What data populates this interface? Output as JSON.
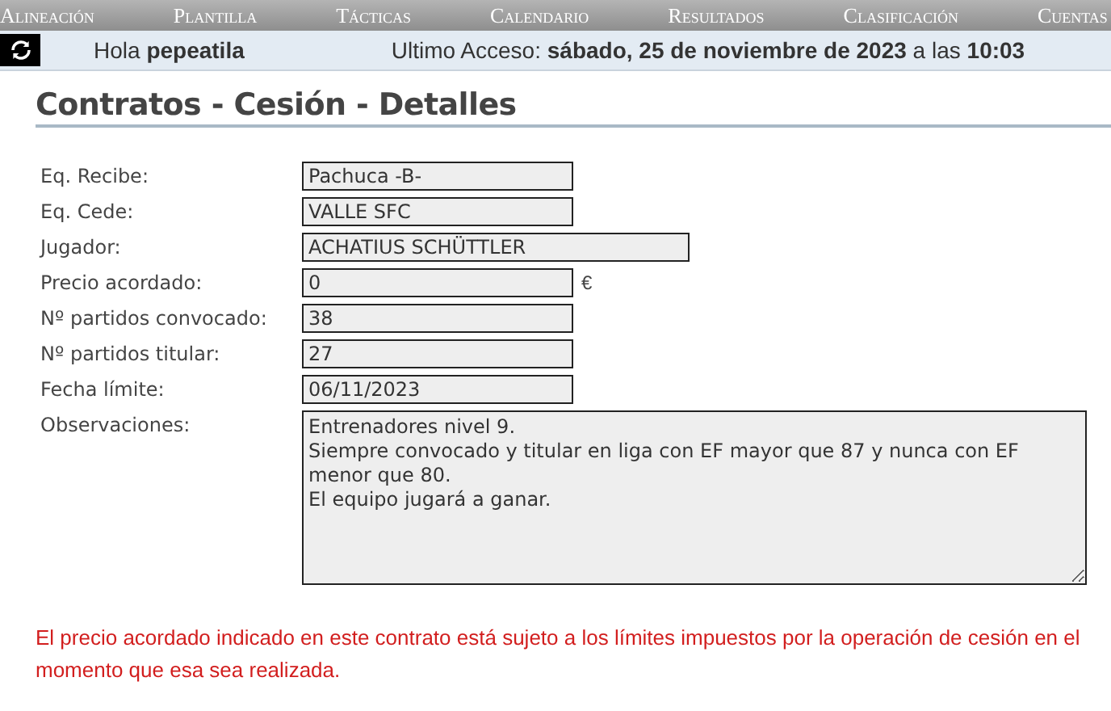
{
  "nav": [
    {
      "label": "Alineación"
    },
    {
      "label": "Plantilla"
    },
    {
      "label": "Tácticas"
    },
    {
      "label": "Calendario"
    },
    {
      "label": "Resultados"
    },
    {
      "label": "Clasificación"
    },
    {
      "label": "Cuentas"
    }
  ],
  "user_bar": {
    "greeting": "Hola **pepeatila**",
    "last_access": "Ultimo Acceso: **sábado, 25 de noviembre de 2023** a las **10:03**"
  },
  "title": "Contratos - Cesión - Detalles",
  "fields": [
    {
      "label": "Eq. Recibe:",
      "value": "Pachuca -B-",
      "kind": "text"
    },
    {
      "label": "Eq. Cede:",
      "value": "VALLE SFC",
      "kind": "text"
    },
    {
      "label": "Jugador:",
      "value": "ACHATIUS SCHÜTTLER",
      "kind": "wide"
    },
    {
      "label": "Precio acordado:",
      "value": "0",
      "kind": "text",
      "unit": "€"
    },
    {
      "label": "Nº partidos convocado:",
      "value": "38",
      "kind": "text"
    },
    {
      "label": "Nº partidos titular:",
      "value": "27",
      "kind": "text"
    },
    {
      "label": "Fecha límite:",
      "value": "06/11/2023",
      "kind": "text"
    },
    {
      "label": "Observaciones:",
      "value": "Entrenadores nivel 9.\nSiempre convocado y titular en liga con EF mayor que 87 y nunca con EF menor que 80.\nEl equipo jugará a ganar.",
      "kind": "textarea"
    }
  ],
  "notice": "El precio acordado indicado en este contrato está sujeto a los límites impuestos por la operación de cesión en el momento que esa sea realizada."
}
